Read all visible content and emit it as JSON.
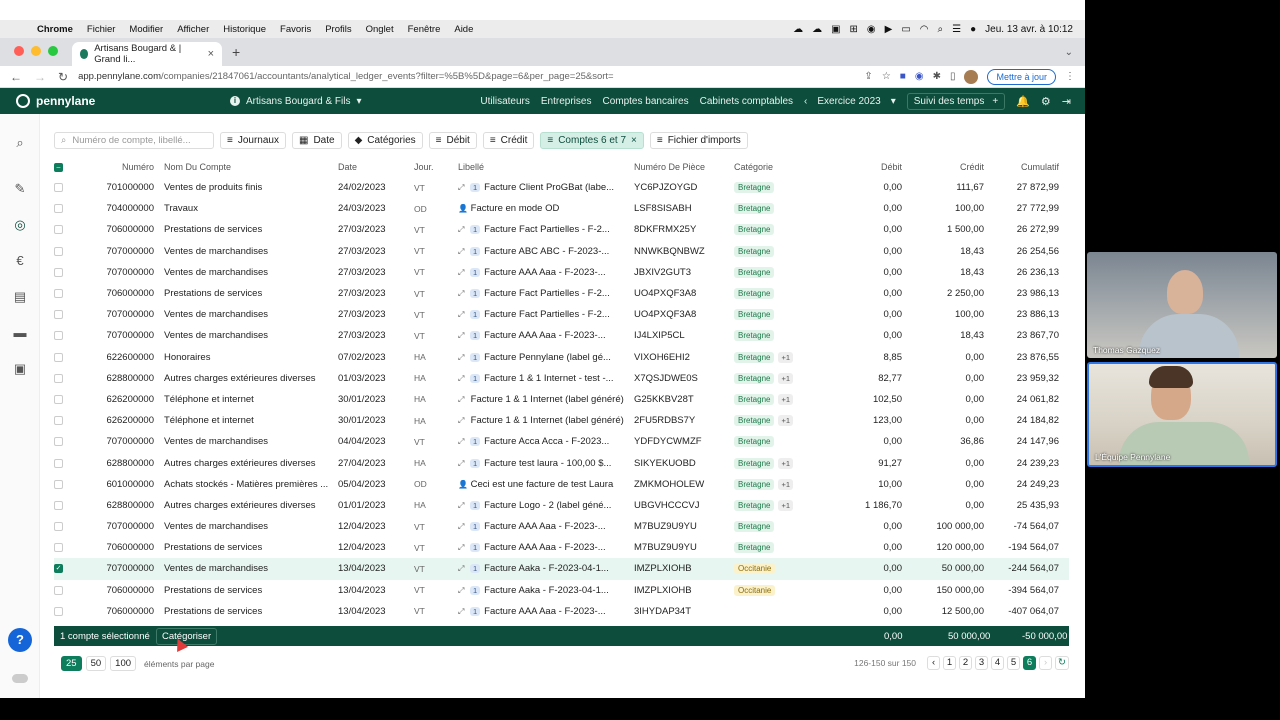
{
  "menubar": {
    "app": "Chrome",
    "items": [
      "Fichier",
      "Modifier",
      "Afficher",
      "Historique",
      "Favoris",
      "Profils",
      "Onglet",
      "Fenêtre",
      "Aide"
    ],
    "clock": "Jeu. 13 avr. à 10:12"
  },
  "browser": {
    "tab_title": "Artisans Bougard & | Grand li...",
    "url_host": "app.pennylane.com",
    "url_path": "/companies/21847061/accountants/analytical_ledger_events?filter=%5B%5D&page=6&per_page=25&sort=",
    "update_label": "Mettre à jour"
  },
  "header": {
    "logo": "pennylane",
    "company": "Artisans Bougard & Fils",
    "nav": [
      "Utilisateurs",
      "Entreprises",
      "Comptes bancaires",
      "Cabinets comptables"
    ],
    "exercise": "Exercice 2023",
    "suivi": "Suivi des temps"
  },
  "filters": {
    "search_placeholder": "Numéro de compte, libellé...",
    "journaux": "Journaux",
    "date": "Date",
    "categories": "Catégories",
    "debit": "Débit",
    "credit": "Crédit",
    "comptes": "Comptes 6 et 7",
    "imports": "Fichier d'imports"
  },
  "columns": {
    "numero": "Numéro",
    "nom": "Nom Du Compte",
    "date": "Date",
    "jour": "Jour.",
    "libelle": "Libellé",
    "piece": "Numéro De Pièce",
    "categorie": "Catégorie",
    "debit": "Débit",
    "credit": "Crédit",
    "cumulatif": "Cumulatif"
  },
  "rows": [
    {
      "num": "701000000",
      "nom": "Ventes de produits finis",
      "date": "24/02/2023",
      "jour": "VT",
      "icon": "link",
      "badge": "1",
      "lib": "Facture Client ProGBat (labe...",
      "piece": "YC6PJZOYGD",
      "cat": "Bretagne",
      "cat_color": "green",
      "plus": "",
      "debit": "0,00",
      "credit": "111,67",
      "cumul": "27 872,99",
      "selected": false
    },
    {
      "num": "704000000",
      "nom": "Travaux",
      "date": "24/03/2023",
      "jour": "OD",
      "icon": "user",
      "badge": "",
      "lib": "Facture en mode OD",
      "piece": "LSF8SISABH",
      "cat": "Bretagne",
      "cat_color": "green",
      "plus": "",
      "debit": "0,00",
      "credit": "100,00",
      "cumul": "27 772,99",
      "selected": false
    },
    {
      "num": "706000000",
      "nom": "Prestations de services",
      "date": "27/03/2023",
      "jour": "VT",
      "icon": "link",
      "badge": "1",
      "lib": "Facture Fact Partielles - F-2...",
      "piece": "8DKFRMX25Y",
      "cat": "Bretagne",
      "cat_color": "green",
      "plus": "",
      "debit": "0,00",
      "credit": "1 500,00",
      "cumul": "26 272,99",
      "selected": false
    },
    {
      "num": "707000000",
      "nom": "Ventes de marchandises",
      "date": "27/03/2023",
      "jour": "VT",
      "icon": "link",
      "badge": "1",
      "lib": "Facture ABC ABC - F-2023-...",
      "piece": "NNWKBQNBWZ",
      "cat": "Bretagne",
      "cat_color": "green",
      "plus": "",
      "debit": "0,00",
      "credit": "18,43",
      "cumul": "26 254,56",
      "selected": false
    },
    {
      "num": "707000000",
      "nom": "Ventes de marchandises",
      "date": "27/03/2023",
      "jour": "VT",
      "icon": "link",
      "badge": "1",
      "lib": "Facture AAA Aaa - F-2023-...",
      "piece": "JBXIV2GUT3",
      "cat": "Bretagne",
      "cat_color": "green",
      "plus": "",
      "debit": "0,00",
      "credit": "18,43",
      "cumul": "26 236,13",
      "selected": false
    },
    {
      "num": "706000000",
      "nom": "Prestations de services",
      "date": "27/03/2023",
      "jour": "VT",
      "icon": "link",
      "badge": "1",
      "lib": "Facture Fact Partielles - F-2...",
      "piece": "UO4PXQF3A8",
      "cat": "Bretagne",
      "cat_color": "green",
      "plus": "",
      "debit": "0,00",
      "credit": "2 250,00",
      "cumul": "23 986,13",
      "selected": false
    },
    {
      "num": "707000000",
      "nom": "Ventes de marchandises",
      "date": "27/03/2023",
      "jour": "VT",
      "icon": "link",
      "badge": "1",
      "lib": "Facture Fact Partielles - F-2...",
      "piece": "UO4PXQF3A8",
      "cat": "Bretagne",
      "cat_color": "green",
      "plus": "",
      "debit": "0,00",
      "credit": "100,00",
      "cumul": "23 886,13",
      "selected": false
    },
    {
      "num": "707000000",
      "nom": "Ventes de marchandises",
      "date": "27/03/2023",
      "jour": "VT",
      "icon": "link",
      "badge": "1",
      "lib": "Facture AAA Aaa - F-2023-...",
      "piece": "IJ4LXIP5CL",
      "cat": "Bretagne",
      "cat_color": "green",
      "plus": "",
      "debit": "0,00",
      "credit": "18,43",
      "cumul": "23 867,70",
      "selected": false
    },
    {
      "num": "622600000",
      "nom": "Honoraires",
      "date": "07/02/2023",
      "jour": "HA",
      "icon": "link",
      "badge": "1",
      "lib": "Facture Pennylane (label gé...",
      "piece": "VIXOH6EHI2",
      "cat": "Bretagne",
      "cat_color": "green",
      "plus": "+1",
      "debit": "8,85",
      "credit": "0,00",
      "cumul": "23 876,55",
      "selected": false
    },
    {
      "num": "628800000",
      "nom": "Autres charges extérieures diverses",
      "date": "01/03/2023",
      "jour": "HA",
      "icon": "link",
      "badge": "1",
      "lib": "Facture 1 & 1 Internet - test -...",
      "piece": "X7QSJDWE0S",
      "cat": "Bretagne",
      "cat_color": "green",
      "plus": "+1",
      "debit": "82,77",
      "credit": "0,00",
      "cumul": "23 959,32",
      "selected": false
    },
    {
      "num": "626200000",
      "nom": "Téléphone et internet",
      "date": "30/01/2023",
      "jour": "HA",
      "icon": "link",
      "badge": "",
      "lib": "Facture 1 & 1 Internet (label généré)",
      "piece": "G25KKBV28T",
      "cat": "Bretagne",
      "cat_color": "green",
      "plus": "+1",
      "debit": "102,50",
      "credit": "0,00",
      "cumul": "24 061,82",
      "selected": false
    },
    {
      "num": "626200000",
      "nom": "Téléphone et internet",
      "date": "30/01/2023",
      "jour": "HA",
      "icon": "link",
      "badge": "",
      "lib": "Facture 1 & 1 Internet (label généré)",
      "piece": "2FU5RDBS7Y",
      "cat": "Bretagne",
      "cat_color": "green",
      "plus": "+1",
      "debit": "123,00",
      "credit": "0,00",
      "cumul": "24 184,82",
      "selected": false
    },
    {
      "num": "707000000",
      "nom": "Ventes de marchandises",
      "date": "04/04/2023",
      "jour": "VT",
      "icon": "link",
      "badge": "1",
      "lib": "Facture Acca Acca - F-2023...",
      "piece": "YDFDYCWMZF",
      "cat": "Bretagne",
      "cat_color": "green",
      "plus": "",
      "debit": "0,00",
      "credit": "36,86",
      "cumul": "24 147,96",
      "selected": false
    },
    {
      "num": "628800000",
      "nom": "Autres charges extérieures diverses",
      "date": "27/04/2023",
      "jour": "HA",
      "icon": "link",
      "badge": "1",
      "lib": "Facture test laura - 100,00 $...",
      "piece": "SIKYEKUOBD",
      "cat": "Bretagne",
      "cat_color": "green",
      "plus": "+1",
      "debit": "91,27",
      "credit": "0,00",
      "cumul": "24 239,23",
      "selected": false
    },
    {
      "num": "601000000",
      "nom": "Achats stockés - Matières premières ...",
      "date": "05/04/2023",
      "jour": "OD",
      "icon": "user",
      "badge": "",
      "lib": "Ceci est une facture de test Laura",
      "piece": "ZMKMOHOLEW",
      "cat": "Bretagne",
      "cat_color": "green",
      "plus": "+1",
      "debit": "10,00",
      "credit": "0,00",
      "cumul": "24 249,23",
      "selected": false
    },
    {
      "num": "628800000",
      "nom": "Autres charges extérieures diverses",
      "date": "01/01/2023",
      "jour": "HA",
      "icon": "link",
      "badge": "1",
      "lib": "Facture Logo - 2 (label géné...",
      "piece": "UBGVHCCCVJ",
      "cat": "Bretagne",
      "cat_color": "green",
      "plus": "+1",
      "debit": "1 186,70",
      "credit": "0,00",
      "cumul": "25 435,93",
      "selected": false
    },
    {
      "num": "707000000",
      "nom": "Ventes de marchandises",
      "date": "12/04/2023",
      "jour": "VT",
      "icon": "link",
      "badge": "1",
      "lib": "Facture AAA Aaa - F-2023-...",
      "piece": "M7BUZ9U9YU",
      "cat": "Bretagne",
      "cat_color": "green",
      "plus": "",
      "debit": "0,00",
      "credit": "100 000,00",
      "cumul": "-74 564,07",
      "selected": false
    },
    {
      "num": "706000000",
      "nom": "Prestations de services",
      "date": "12/04/2023",
      "jour": "VT",
      "icon": "link",
      "badge": "1",
      "lib": "Facture AAA Aaa - F-2023-...",
      "piece": "M7BUZ9U9YU",
      "cat": "Bretagne",
      "cat_color": "green",
      "plus": "",
      "debit": "0,00",
      "credit": "120 000,00",
      "cumul": "-194 564,07",
      "selected": false
    },
    {
      "num": "707000000",
      "nom": "Ventes de marchandises",
      "date": "13/04/2023",
      "jour": "VT",
      "icon": "link",
      "badge": "1",
      "lib": "Facture Aaka - F-2023-04-1...",
      "piece": "IMZPLXIOHB",
      "cat": "Occitanie",
      "cat_color": "yellow",
      "plus": "",
      "debit": "0,00",
      "credit": "50 000,00",
      "cumul": "-244 564,07",
      "selected": true
    },
    {
      "num": "706000000",
      "nom": "Prestations de services",
      "date": "13/04/2023",
      "jour": "VT",
      "icon": "link",
      "badge": "1",
      "lib": "Facture Aaka - F-2023-04-1...",
      "piece": "IMZPLXIOHB",
      "cat": "Occitanie",
      "cat_color": "yellow",
      "plus": "",
      "debit": "0,00",
      "credit": "150 000,00",
      "cumul": "-394 564,07",
      "selected": false
    },
    {
      "num": "706000000",
      "nom": "Prestations de services",
      "date": "13/04/2023",
      "jour": "VT",
      "icon": "link",
      "badge": "1",
      "lib": "Facture AAA Aaa - F-2023-...",
      "piece": "3IHYDAP34T",
      "cat": "",
      "cat_color": "",
      "plus": "",
      "debit": "0,00",
      "credit": "12 500,00",
      "cumul": "-407 064,07",
      "selected": false
    }
  ],
  "selection_bar": {
    "count": "1 compte sélectionné",
    "action": "Catégoriser",
    "debit": "0,00",
    "credit": "50 000,00",
    "cumul": "-50 000,00"
  },
  "pagination": {
    "sizes": [
      "25",
      "50",
      "100"
    ],
    "per_page_label": "éléments par page",
    "range": "126-150 sur 150",
    "pages": [
      "1",
      "2",
      "3",
      "4",
      "5",
      "6"
    ],
    "current": "6"
  },
  "video": {
    "participant1": "Thomas Gazquez",
    "participant2": "L'Équipe Pennylane"
  },
  "colors": {
    "brand": "#0d4d3c",
    "accent": "#0d7d5c"
  }
}
